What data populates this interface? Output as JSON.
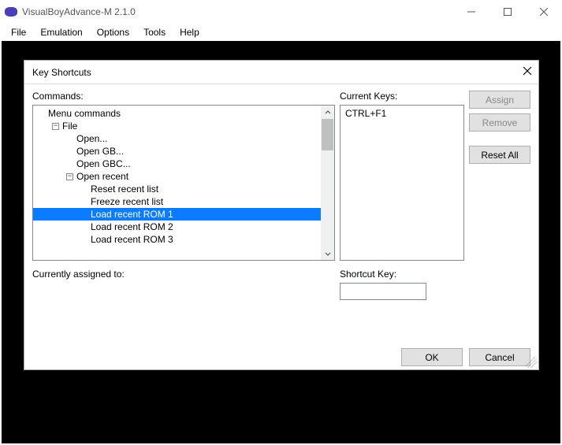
{
  "window": {
    "title": "VisualBoyAdvance-M 2.1.0"
  },
  "menubar": {
    "items": [
      "File",
      "Emulation",
      "Options",
      "Tools",
      "Help"
    ]
  },
  "dialog": {
    "title": "Key Shortcuts",
    "commands_label": "Commands:",
    "current_keys_label": "Current Keys:",
    "currently_assigned_label": "Currently assigned to:",
    "shortcut_key_label": "Shortcut Key:",
    "buttons": {
      "assign": "Assign",
      "remove": "Remove",
      "reset_all": "Reset All",
      "ok": "OK",
      "cancel": "Cancel"
    },
    "current_keys": [
      "CTRL+F1"
    ],
    "tree": [
      {
        "indent": 0,
        "expander": "",
        "label": "Menu commands"
      },
      {
        "indent": 1,
        "expander": "-",
        "label": "File"
      },
      {
        "indent": 2,
        "expander": "",
        "label": "Open..."
      },
      {
        "indent": 2,
        "expander": "",
        "label": "Open GB..."
      },
      {
        "indent": 2,
        "expander": "",
        "label": "Open GBC..."
      },
      {
        "indent": 2,
        "expander": "-",
        "label": "Open recent"
      },
      {
        "indent": 3,
        "expander": "",
        "label": "Reset recent list"
      },
      {
        "indent": 3,
        "expander": "",
        "label": "Freeze recent list"
      },
      {
        "indent": 3,
        "expander": "",
        "label": "Load recent ROM 1",
        "selected": true
      },
      {
        "indent": 3,
        "expander": "",
        "label": "Load recent ROM 2"
      },
      {
        "indent": 3,
        "expander": "",
        "label": "Load recent ROM 3"
      }
    ]
  }
}
